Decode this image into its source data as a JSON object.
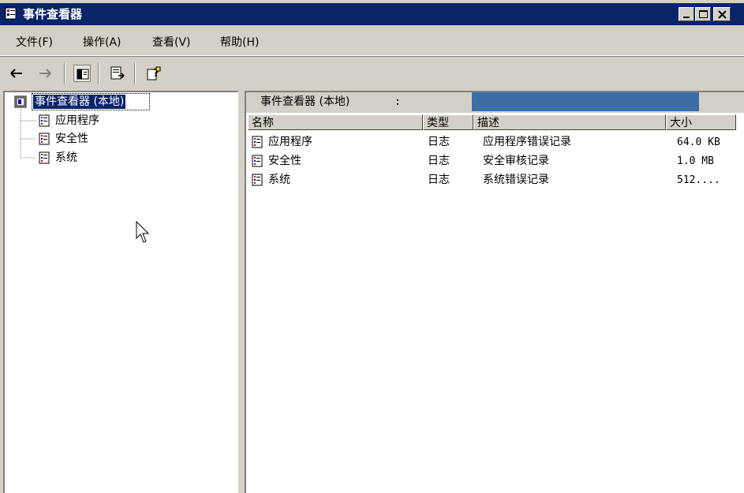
{
  "window": {
    "title": "事件查看器"
  },
  "menu": {
    "items": [
      "文件(F)",
      "操作(A)",
      "查看(V)",
      "帮助(H)"
    ]
  },
  "toolbar": {
    "buttons": [
      {
        "icon": "back-arrow-icon"
      },
      {
        "icon": "forward-arrow-icon"
      },
      {
        "icon": "show-hide-tree-icon"
      },
      {
        "icon": "export-list-icon"
      },
      {
        "icon": "help-icon"
      }
    ]
  },
  "tree": {
    "root": "事件查看器 (本地)",
    "children": [
      "应用程序",
      "安全性",
      "系统"
    ]
  },
  "right": {
    "header": "事件查看器 (本地)",
    "columns": [
      "名称",
      "类型",
      "描述",
      "大小"
    ],
    "rows": [
      {
        "name": "应用程序",
        "type": "日志",
        "desc": "应用程序错误记录",
        "size": "64.0 KB"
      },
      {
        "name": "安全性",
        "type": "日志",
        "desc": "安全审核记录",
        "size": "1.0 MB"
      },
      {
        "name": "系统",
        "type": "日志",
        "desc": "系统错误记录",
        "size": "512...."
      }
    ]
  },
  "colors": {
    "titlebar": "#0a246a",
    "face": "#d4d0c8",
    "selection": "#0a246a",
    "progress": "#3a6ea5"
  }
}
